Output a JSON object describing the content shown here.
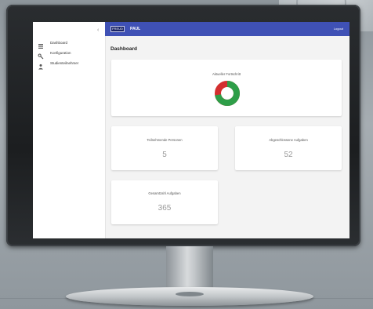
{
  "topbar": {
    "logo_text": "FREUD",
    "app_title": "PAUL",
    "logout_label": "Logout"
  },
  "sidebar": {
    "items": [
      {
        "label": "Dashboard",
        "icon": "grid-icon"
      },
      {
        "label": "Konfiguration",
        "icon": "wrench-icon"
      },
      {
        "label": "Studienteilnehmer",
        "icon": "person-icon"
      }
    ]
  },
  "main": {
    "page_title": "Dashboard",
    "study_progress": {
      "title": "Aktueller Fortschritt",
      "completed_fraction": 0.72,
      "colors": {
        "completed": "#2e9e48",
        "remaining": "#d32f2f"
      }
    },
    "stats": [
      {
        "title": "Teilnehmende Personen",
        "value": "5"
      },
      {
        "title": "Abgeschlossene Aufgaben",
        "value": "52"
      },
      {
        "title": "Gesamtzahl Aufgaben",
        "value": "365"
      }
    ]
  },
  "colors": {
    "topbar": "#3f51b5",
    "screen_bg": "#f3f3f3"
  }
}
